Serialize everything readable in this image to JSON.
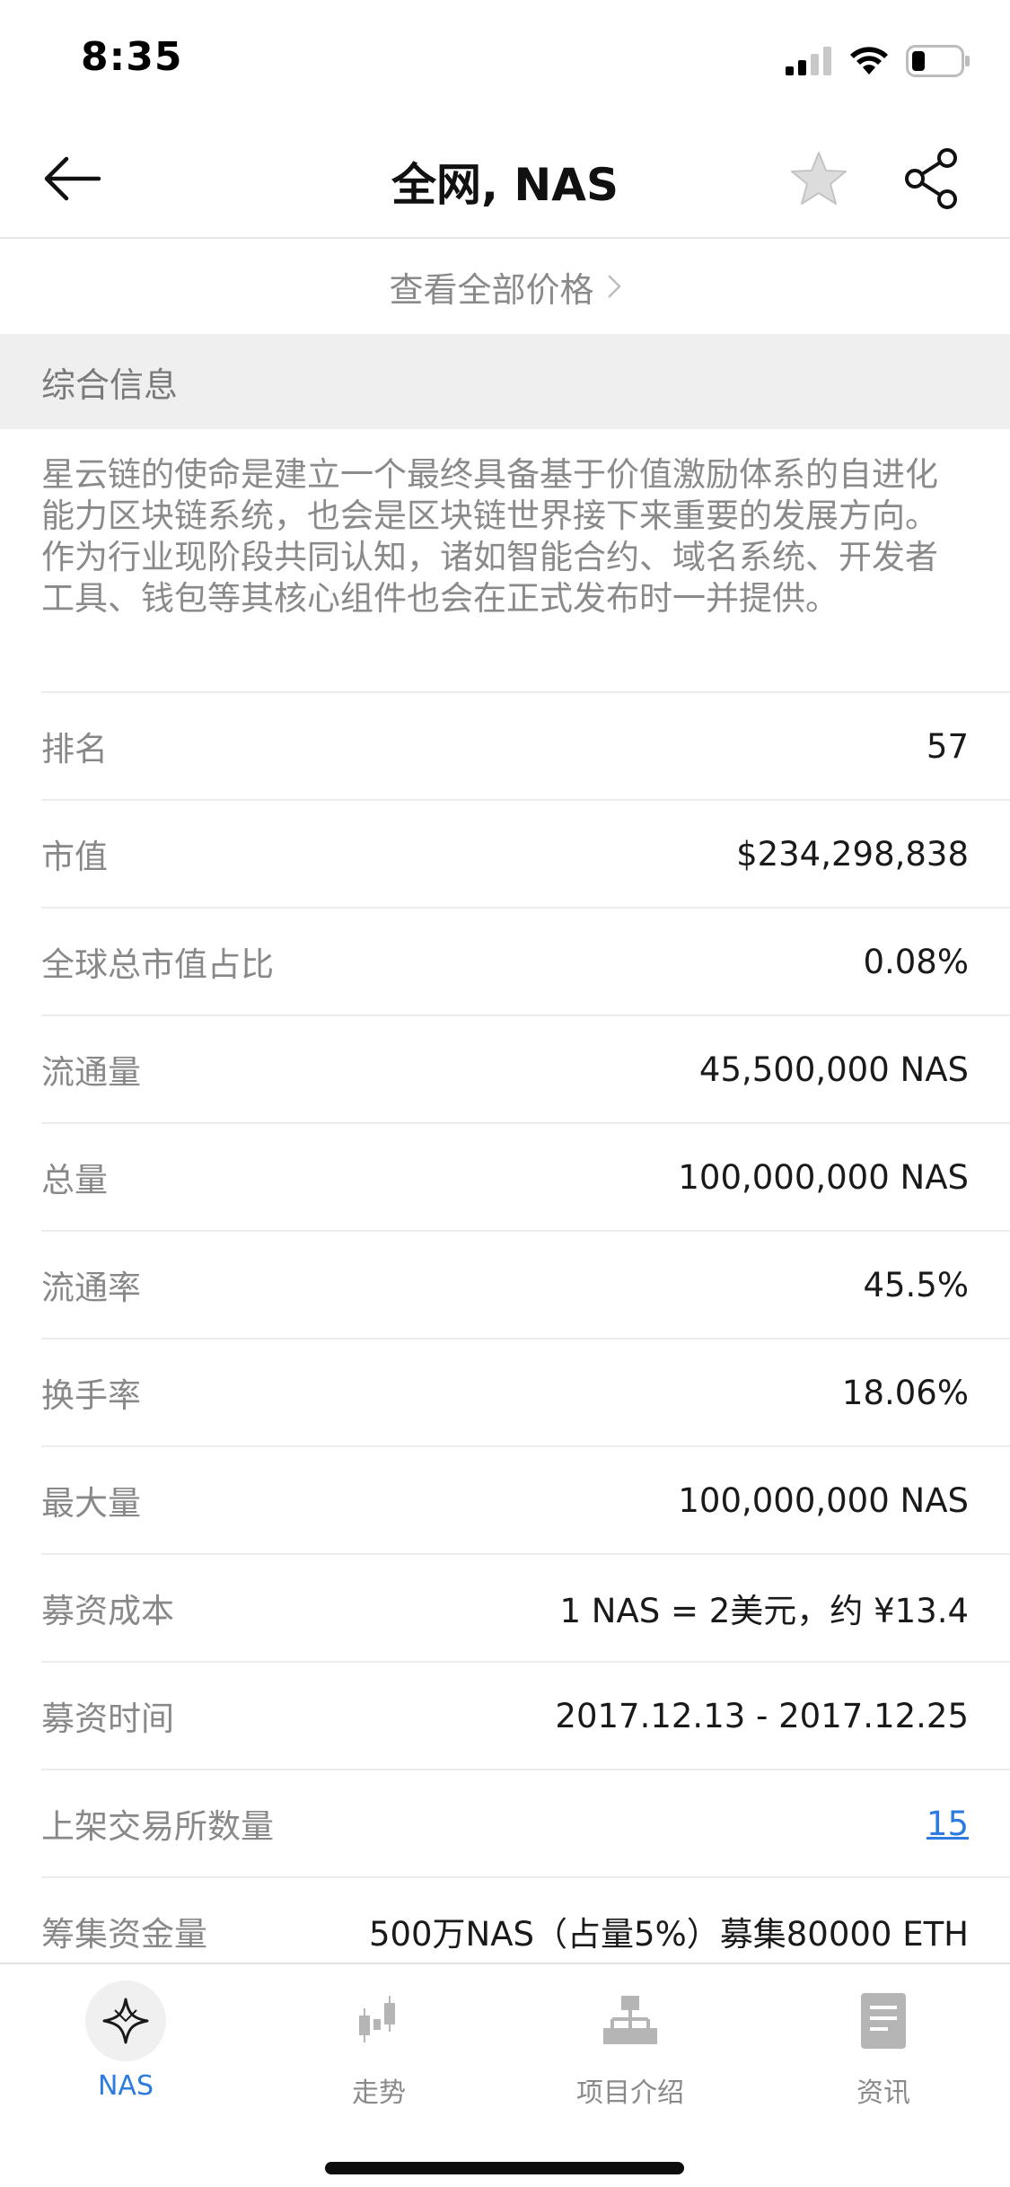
{
  "status_bar": {
    "time": "8:35"
  },
  "nav": {
    "title": "全网, NAS"
  },
  "view_all_prices": "查看全部价格",
  "section_title": "综合信息",
  "description": "星云链的使命是建立一个最终具备基于价值激励体系的自进化能力区块链系统，也会是区块链世界接下来重要的发展方向。作为行业现阶段共同认知，诸如智能合约、域名系统、开发者工具、钱包等其核心组件也会在正式发布时一并提供。",
  "rows": [
    {
      "label": "排名",
      "value": "57"
    },
    {
      "label": "市值",
      "value": "$234,298,838"
    },
    {
      "label": "全球总市值占比",
      "value": "0.08%"
    },
    {
      "label": "流通量",
      "value": "45,500,000 NAS"
    },
    {
      "label": "总量",
      "value": "100,000,000 NAS"
    },
    {
      "label": "流通率",
      "value": "45.5%"
    },
    {
      "label": "换手率",
      "value": "18.06%"
    },
    {
      "label": "最大量",
      "value": "100,000,000 NAS"
    },
    {
      "label": "募资成本",
      "value": "1 NAS = 2美元，约 ¥13.4"
    },
    {
      "label": "募资时间",
      "value": "2017.12.13 - 2017.12.25"
    },
    {
      "label": "上架交易所数量",
      "value": "15"
    },
    {
      "label": "筹集资金量",
      "value": "500万NAS（占量5%）募集80000 ETH"
    }
  ],
  "tabs": [
    {
      "label": "NAS",
      "icon": "nas-logo-icon",
      "active": true
    },
    {
      "label": "走势",
      "icon": "candlestick-chart-icon",
      "active": false
    },
    {
      "label": "项目介绍",
      "icon": "org-chart-icon",
      "active": false
    },
    {
      "label": "资讯",
      "icon": "news-document-icon",
      "active": false
    }
  ],
  "colors": {
    "accent": "#2d7be0",
    "muted_text": "#8a8a8a",
    "section_bg": "#efefef"
  }
}
